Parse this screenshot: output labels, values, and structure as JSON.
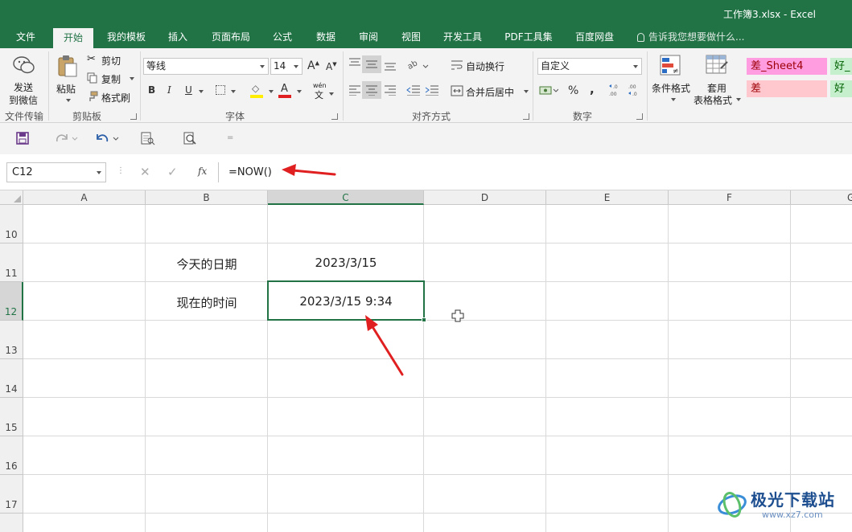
{
  "window": {
    "title": "工作簿3.xlsx - Excel"
  },
  "tabs": [
    "文件",
    "开始",
    "我的模板",
    "插入",
    "页面布局",
    "公式",
    "数据",
    "审阅",
    "视图",
    "开发工具",
    "PDF工具集",
    "百度网盘"
  ],
  "tell_me": "告诉我您想要做什么...",
  "ribbon": {
    "wechat": {
      "line1": "发送",
      "line2": "到微信",
      "group": "文件传输"
    },
    "clipboard": {
      "paste": "粘贴",
      "cut": "剪切",
      "copy": "复制",
      "format_painter": "格式刷",
      "group": "剪贴板"
    },
    "font": {
      "name": "等线",
      "size": "14",
      "bold": "B",
      "italic": "I",
      "underline": "U",
      "wen": "wén",
      "group": "字体"
    },
    "alignment": {
      "wrap": "自动换行",
      "merge": "合并后居中",
      "group": "对齐方式"
    },
    "number": {
      "format": "自定义",
      "percent": "%",
      "comma": ",",
      "group": "数字"
    },
    "styles": {
      "conditional_line1": "条件格式",
      "table_line1": "套用",
      "table_line2": "表格格式",
      "bad_sheet": "差_Sheet4",
      "good_partial": "好_",
      "bad": "差",
      "good": "好"
    }
  },
  "formula_bar": {
    "name_box": "C12",
    "fx": "fx",
    "formula": "=NOW()"
  },
  "grid": {
    "columns": [
      "A",
      "B",
      "C",
      "D",
      "E",
      "F",
      "G"
    ],
    "rows": [
      "10",
      "11",
      "12",
      "13",
      "14",
      "15",
      "16",
      "17"
    ],
    "cells": {
      "B11": "今天的日期",
      "C11": "2023/3/15",
      "B12": "现在的时间",
      "C12": "2023/3/15 9:34"
    }
  },
  "watermark": {
    "name": "极光下载站",
    "url": "www.xz7.com"
  },
  "colors": {
    "excel_green": "#217346",
    "bad_style_bg": "#ffc7ce",
    "good_style_bg": "#c6efce",
    "annotation_red": "#e02020"
  }
}
